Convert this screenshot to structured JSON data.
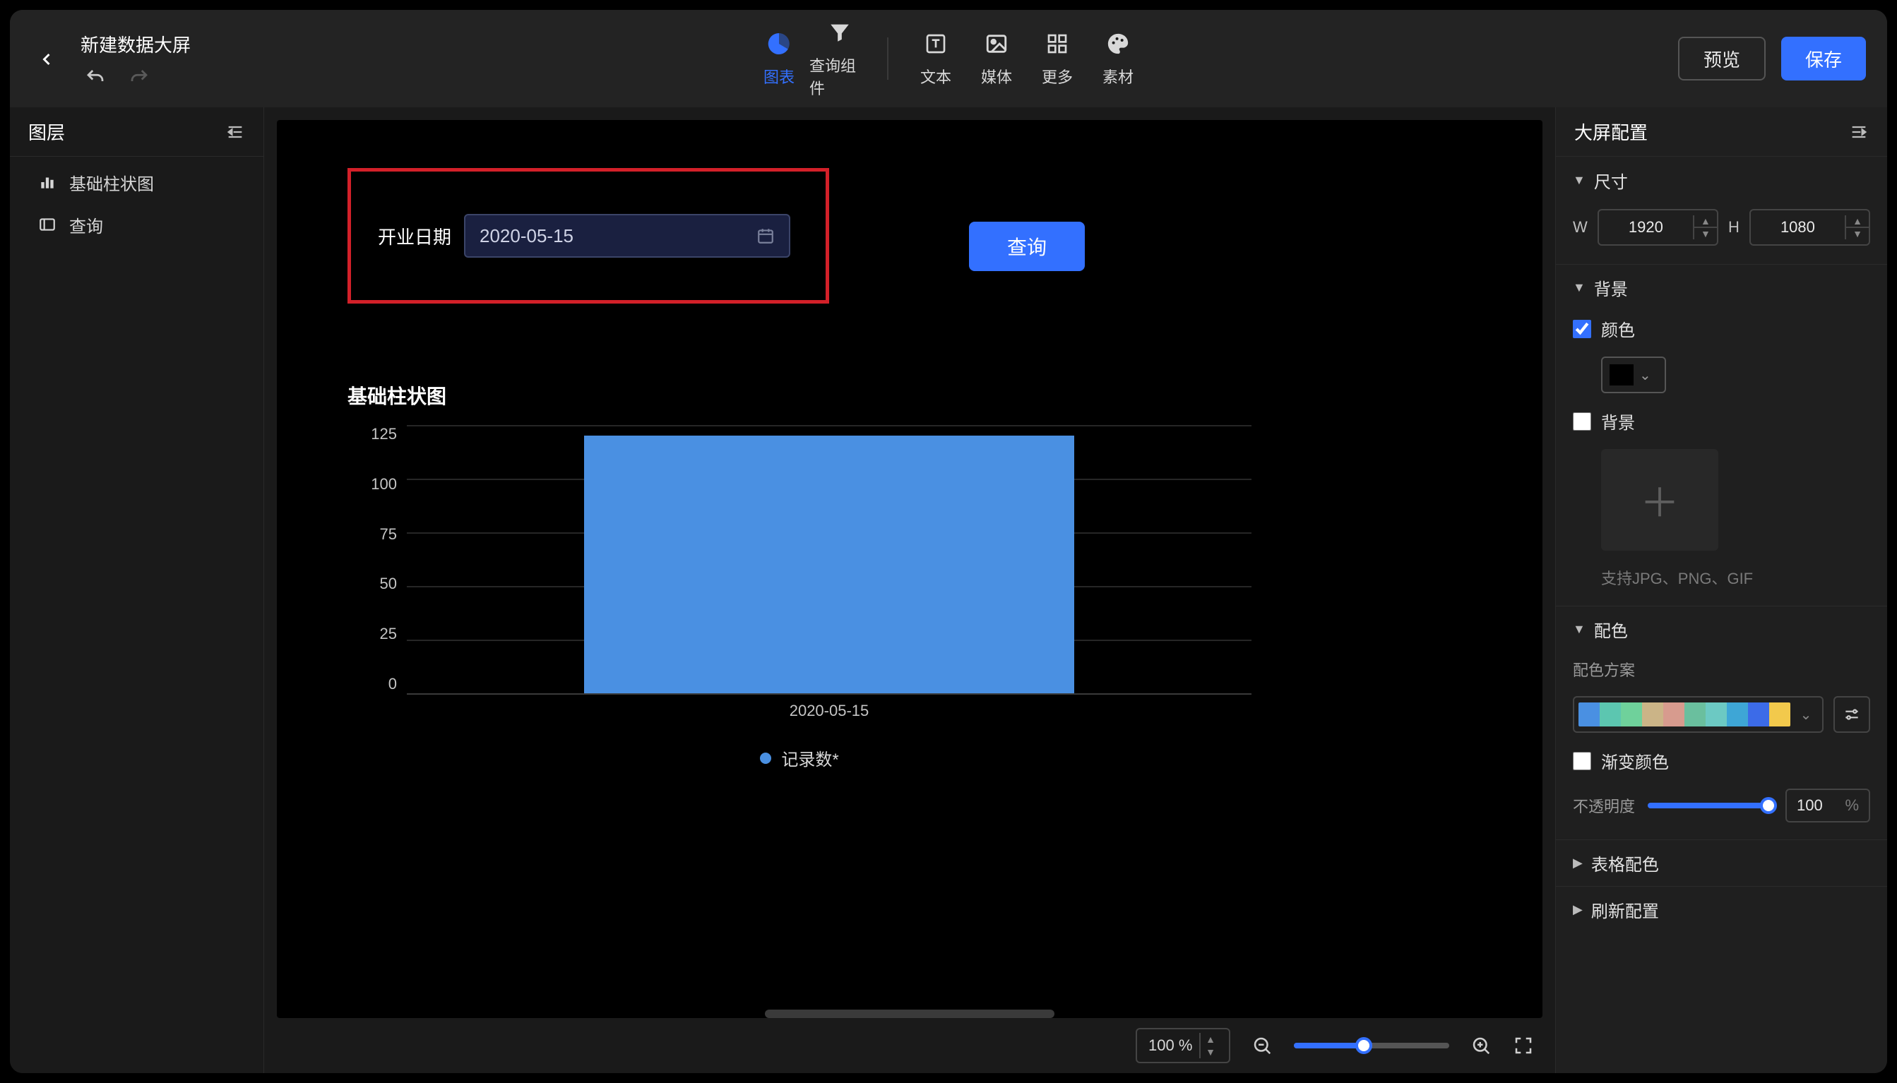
{
  "header": {
    "title": "新建数据大屏",
    "toolbar": {
      "chart": "图表",
      "query": "查询组件",
      "text": "文本",
      "media": "媒体",
      "more": "更多",
      "material": "素材"
    },
    "preview": "预览",
    "save": "保存"
  },
  "left": {
    "title": "图层",
    "items": [
      {
        "icon": "bar-chart",
        "label": "基础柱状图"
      },
      {
        "icon": "query",
        "label": "查询"
      }
    ]
  },
  "canvas": {
    "filter_label": "开业日期",
    "filter_value": "2020-05-15",
    "query_button": "查询"
  },
  "chart_data": {
    "type": "bar",
    "title": "基础柱状图",
    "categories": [
      "2020-05-15"
    ],
    "series": [
      {
        "name": "记录数*",
        "values": [
          120
        ]
      }
    ],
    "y_ticks": [
      125,
      100,
      75,
      50,
      25,
      0
    ],
    "ylim": [
      0,
      125
    ],
    "x_label": "2020-05-15",
    "legend": "记录数*"
  },
  "footer": {
    "zoom_display": "100 %"
  },
  "right": {
    "title": "大屏配置",
    "sections": {
      "size": "尺寸",
      "bg": "背景",
      "palette": "配色",
      "table_palette": "表格配色",
      "refresh": "刷新配置"
    },
    "size_w_label": "W",
    "size_w": "1920",
    "size_h_label": "H",
    "size_h": "1080",
    "color_chk": "颜色",
    "bg_chk": "背景",
    "upload_hint": "支持JPG、PNG、GIF",
    "scheme_label": "配色方案",
    "gradient_chk": "渐变颜色",
    "opacity_label": "不透明度",
    "opacity_value": "100",
    "opacity_unit": "%",
    "palette_colors": [
      "#4a90e2",
      "#5cc6b0",
      "#6fd19b",
      "#cbb487",
      "#d79b8e",
      "#6abf9e",
      "#6cc9c3",
      "#3ea6d6",
      "#3c6be8",
      "#f2c94c"
    ]
  }
}
